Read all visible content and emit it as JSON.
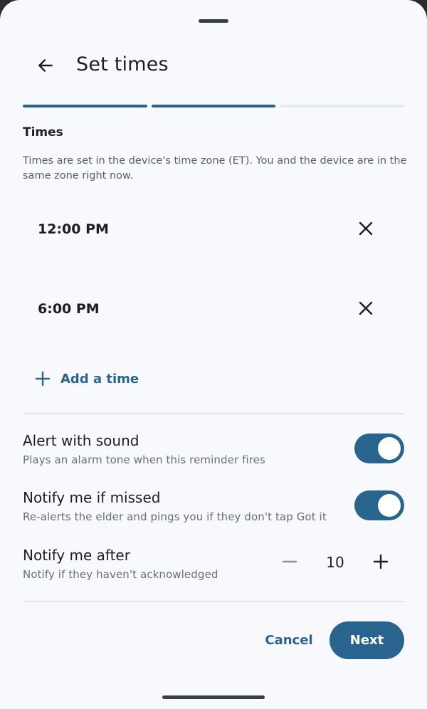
{
  "header": {
    "title": "Set times",
    "back_icon": "arrow-left-icon"
  },
  "progress": {
    "total_steps": 3,
    "completed_steps": 2,
    "accent": "#29648f"
  },
  "times_section": {
    "title": "Times",
    "description": "Times are set in the device's time zone (ET). You and the device are in the same zone right now.",
    "times": [
      {
        "label": "12:00 PM",
        "remove_icon": "close-icon"
      },
      {
        "label": "6:00 PM",
        "remove_icon": "close-icon"
      }
    ],
    "add_label": "Add a time"
  },
  "settings": {
    "alert_sound": {
      "title": "Alert with sound",
      "subtitle": "Plays an alarm tone when this reminder fires",
      "enabled": true
    },
    "notify_missed": {
      "title": "Notify me if missed",
      "subtitle": "Re-alerts the elder and pings you if they don't tap Got it",
      "enabled": true
    },
    "notify_after": {
      "title": "Notify me after",
      "subtitle": "Notify if they haven't acknowledged",
      "value": "10"
    }
  },
  "actions": {
    "cancel_label": "Cancel",
    "next_label": "Next"
  },
  "colors": {
    "accent": "#29648f",
    "background": "#f7f9fc"
  }
}
